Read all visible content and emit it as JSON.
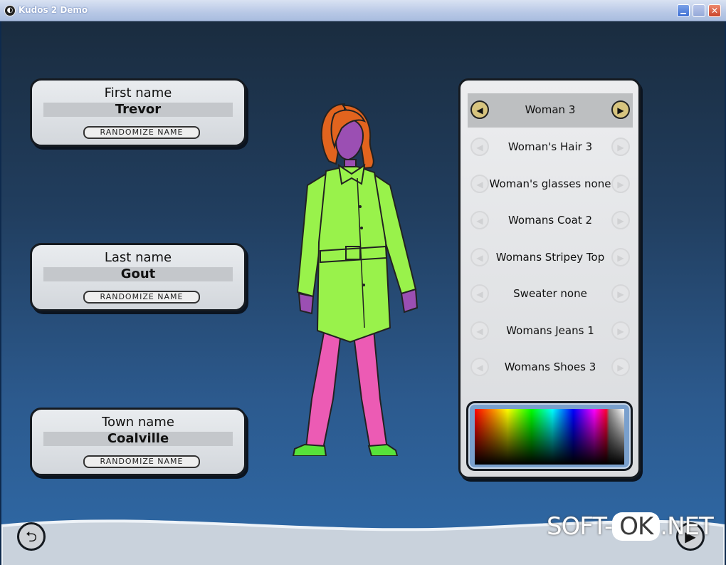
{
  "window": {
    "title": "Kudos 2 Demo",
    "close_glyph": "✕"
  },
  "name_panels": [
    {
      "label": "First name",
      "value": "Trevor",
      "button": "RANDOMIZE NAME"
    },
    {
      "label": "Last name",
      "value": "Gout",
      "button": "RANDOMIZE NAME"
    },
    {
      "label": "Town name",
      "value": "Coalville",
      "button": "RANDOMIZE NAME"
    }
  ],
  "attributes": [
    {
      "label": "Woman 3",
      "selected": true
    },
    {
      "label": "Woman's Hair 3",
      "selected": false
    },
    {
      "label": "Woman's glasses none",
      "selected": false
    },
    {
      "label": "Womans Coat 2",
      "selected": false
    },
    {
      "label": "Womans Stripey Top",
      "selected": false
    },
    {
      "label": "Sweater none",
      "selected": false
    },
    {
      "label": "Womans Jeans 1",
      "selected": false
    },
    {
      "label": "Womans Shoes 3",
      "selected": false
    }
  ],
  "character": {
    "hair_color": "#e2641e",
    "skin_color": "#9b4fb3",
    "coat_color": "#99f24b",
    "pants_color": "#ec5bb4",
    "shoes_color": "#57e23a"
  },
  "icons": {
    "back": "exit-circle-icon",
    "next": "next-arrow-icon",
    "arrow_left": "arrow-left-icon",
    "arrow_right": "arrow-right-icon"
  },
  "watermark": {
    "part1": "SOFT-",
    "part2": "OK",
    "part3": ".NET"
  }
}
